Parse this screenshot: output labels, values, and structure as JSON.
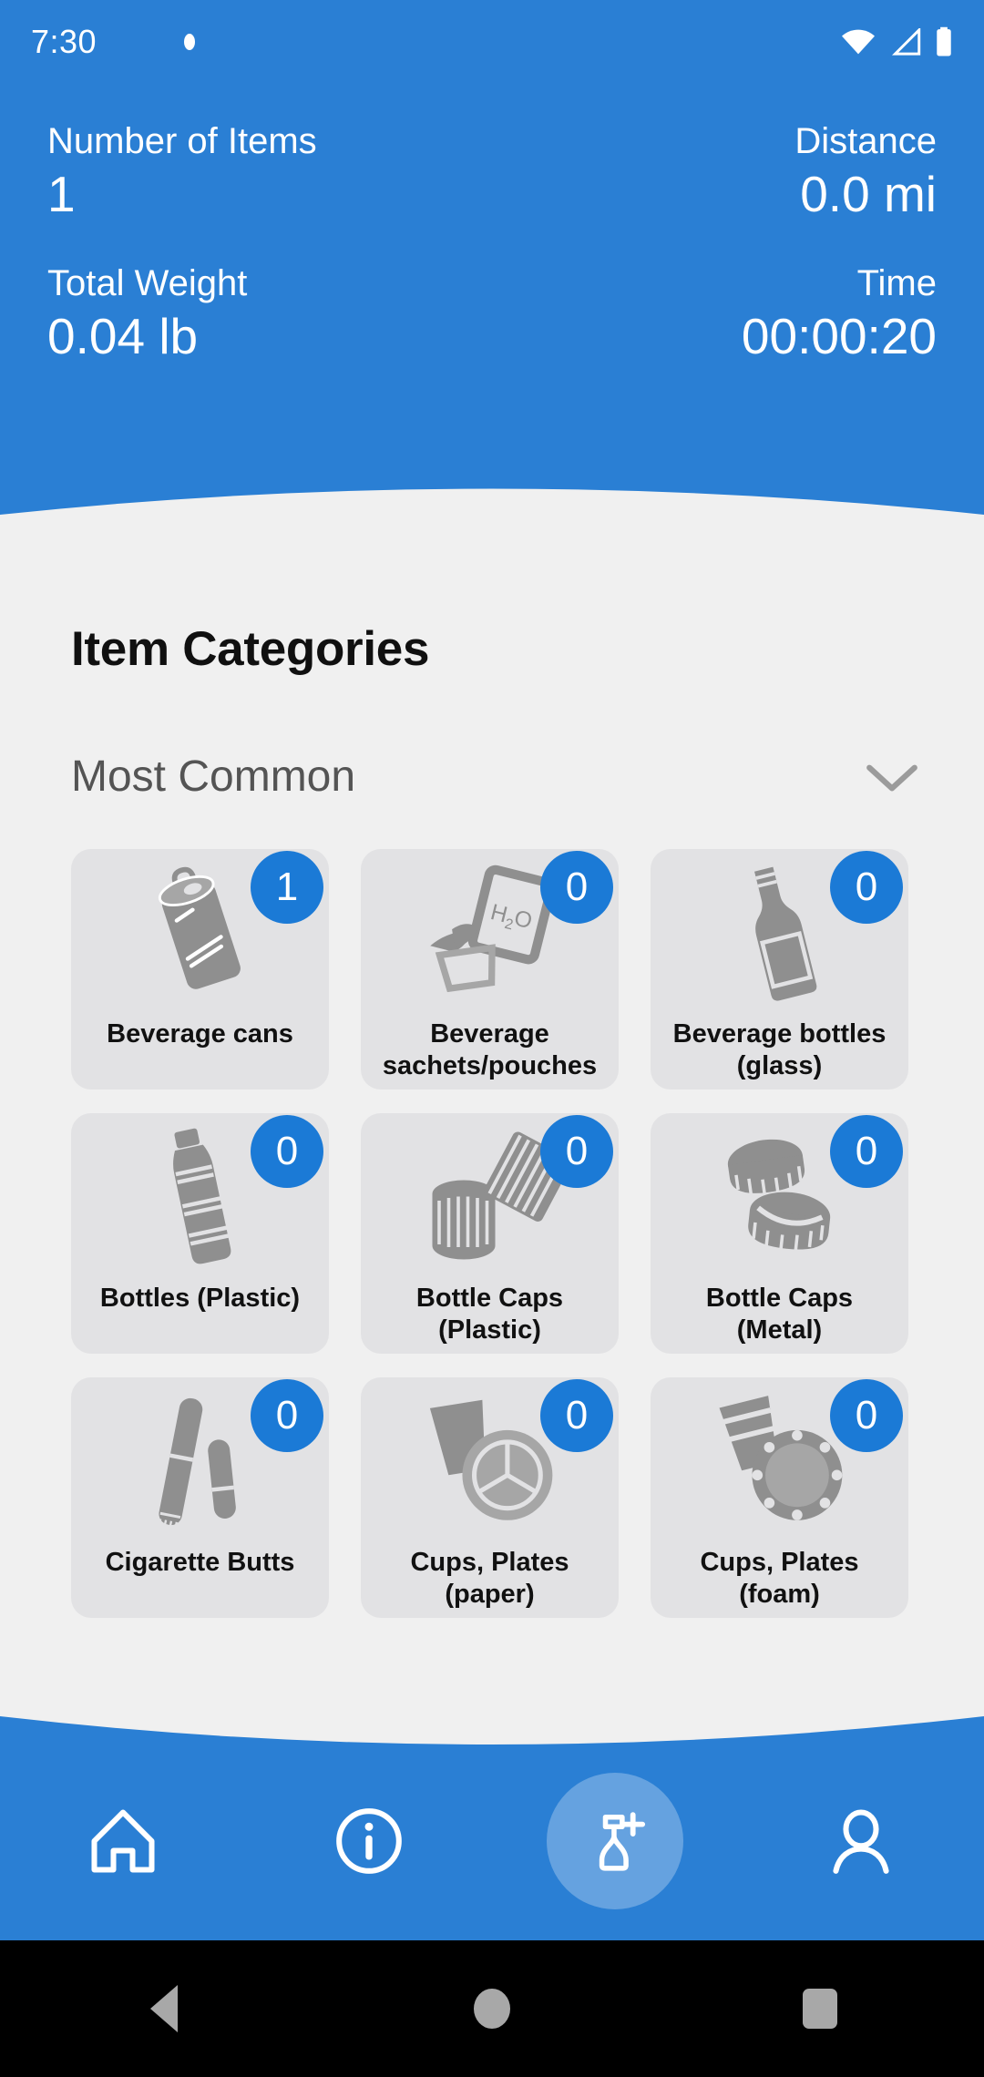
{
  "theme": {
    "brand_blue": "#2a7fd4",
    "badge_blue": "#1b7ad6",
    "page_bg": "#f0f0f0",
    "card_bg": "#e2e2e4"
  },
  "status_bar": {
    "time": "7:30",
    "icons": [
      "wifi-icon",
      "cellular-signal-icon",
      "battery-icon"
    ]
  },
  "header_stats": [
    {
      "left": {
        "label": "Number of Items",
        "value": "1"
      },
      "right": {
        "label": "Distance",
        "value": "0.0 mi"
      }
    },
    {
      "left": {
        "label": "Total Weight",
        "value": "0.04 lb"
      },
      "right": {
        "label": "Time",
        "value": "00:00:20"
      }
    }
  ],
  "main": {
    "page_title": "Item Categories",
    "section": {
      "title": "Most Common",
      "expand_icon": "chevron-down-icon"
    }
  },
  "categories": [
    {
      "label": "Beverage cans",
      "count": "1",
      "icon": "beverage-can-icon"
    },
    {
      "label": "Beverage\nsachets/pouches",
      "count": "0",
      "icon": "beverage-pouch-icon"
    },
    {
      "label": "Beverage bottles\n(glass)",
      "count": "0",
      "icon": "glass-bottle-icon"
    },
    {
      "label": "Bottles (Plastic)",
      "count": "0",
      "icon": "plastic-bottle-icon"
    },
    {
      "label": "Bottle Caps\n(Plastic)",
      "count": "0",
      "icon": "plastic-cap-icon"
    },
    {
      "label": "Bottle Caps\n(Metal)",
      "count": "0",
      "icon": "metal-cap-icon"
    },
    {
      "label": "Cigarette Butts",
      "count": "0",
      "icon": "cigarette-butt-icon"
    },
    {
      "label": "Cups, Plates\n(paper)",
      "count": "0",
      "icon": "paper-cup-plate-icon"
    },
    {
      "label": "Cups, Plates\n(foam)",
      "count": "0",
      "icon": "foam-cup-plate-icon"
    }
  ],
  "bottom_nav": [
    {
      "name": "home",
      "icon": "home-icon",
      "active": false
    },
    {
      "name": "info",
      "icon": "info-icon",
      "active": false
    },
    {
      "name": "add-bag",
      "icon": "add-trash-bag-icon",
      "active": true
    },
    {
      "name": "profile",
      "icon": "person-icon",
      "active": false
    }
  ],
  "system_nav": [
    {
      "name": "back",
      "icon": "back-triangle-icon"
    },
    {
      "name": "home",
      "icon": "home-circle-icon"
    },
    {
      "name": "recents",
      "icon": "recents-square-icon"
    }
  ]
}
